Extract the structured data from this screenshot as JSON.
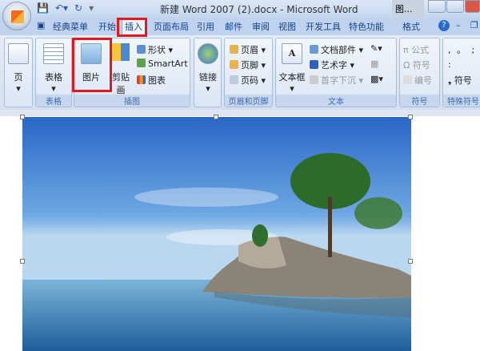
{
  "titlebar": {
    "title": "新建 Word 2007 (2).docx - Microsoft Word",
    "context_tab": "图..."
  },
  "tabs": [
    {
      "label": "经典菜单"
    },
    {
      "label": "开始"
    },
    {
      "label": "插入",
      "active": true
    },
    {
      "label": "页面布局"
    },
    {
      "label": "引用"
    },
    {
      "label": "邮件"
    },
    {
      "label": "审阅"
    },
    {
      "label": "视图"
    },
    {
      "label": "开发工具"
    },
    {
      "label": "特色功能"
    },
    {
      "label": "格式"
    }
  ],
  "ribbon": {
    "page": {
      "button": "页",
      "label": ""
    },
    "table": {
      "button": "表格",
      "label": "表格"
    },
    "illustrations": {
      "picture": "图片",
      "clipart": "剪贴画",
      "shapes": "形状",
      "smartart": "SmartArt",
      "chart": "图表",
      "label": "插图"
    },
    "links": {
      "button": "链接",
      "label": ""
    },
    "header_footer": {
      "header": "页眉",
      "footer": "页脚",
      "page_number": "页码",
      "label": "页眉和页脚"
    },
    "text": {
      "textbox": "文本框",
      "quickparts": "文档部件",
      "wordart": "艺术字",
      "dropcap": "首字下沉",
      "label": "文本"
    },
    "symbols": {
      "equation": "公式",
      "symbol": "符号",
      "number": "编号",
      "label": "符号"
    },
    "special": {
      "symbol": "符号",
      "punct": ", 。 ; :",
      "label": "特殊符号"
    }
  },
  "colors": {
    "highlight": "#e0191e",
    "tab_bg": "#bfd3ee"
  }
}
